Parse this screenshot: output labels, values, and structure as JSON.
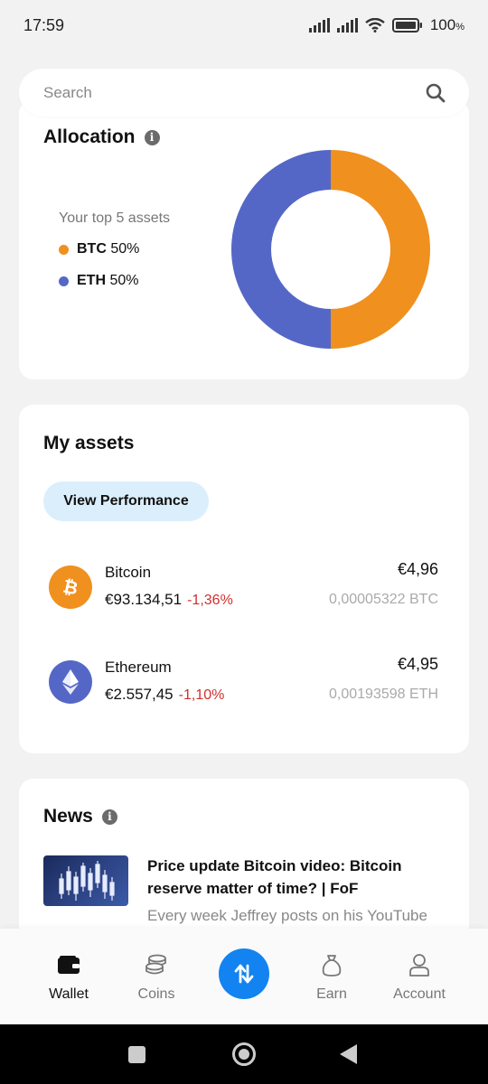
{
  "status_bar": {
    "time": "17:59",
    "battery": "100",
    "battery_unit": "%"
  },
  "search": {
    "placeholder": "Search"
  },
  "allocation": {
    "title": "Allocation",
    "subtitle": "Your top 5 assets",
    "legend": [
      {
        "symbol": "BTC",
        "percent": "50%",
        "color": "#f0901e"
      },
      {
        "symbol": "ETH",
        "percent": "50%",
        "color": "#5567c6"
      }
    ]
  },
  "chart_data": {
    "type": "pie",
    "categories": [
      "BTC",
      "ETH"
    ],
    "values": [
      50,
      50
    ],
    "colors": [
      "#f0901e",
      "#5567c6"
    ],
    "title": "Allocation"
  },
  "assets": {
    "title": "My assets",
    "performance_button": "View Performance",
    "items": [
      {
        "name": "Bitcoin",
        "price": "€93.134,51",
        "change": "-1,36%",
        "value": "€4,96",
        "amount": "0,00005322 BTC",
        "icon": "bitcoin-icon",
        "color": "#f0901e"
      },
      {
        "name": "Ethereum",
        "price": "€2.557,45",
        "change": "-1,10%",
        "value": "€4,95",
        "amount": "0,00193598 ETH",
        "icon": "ethereum-icon",
        "color": "#5567c6"
      }
    ]
  },
  "news": {
    "title": "News",
    "article": {
      "title": "Price update Bitcoin video: Bitcoin reserve matter of time? | FoF",
      "snippet": "Every week Jeffrey posts on his YouTube"
    }
  },
  "nav": {
    "wallet": "Wallet",
    "coins": "Coins",
    "earn": "Earn",
    "account": "Account",
    "active": "wallet",
    "accent": "#1283f0"
  }
}
